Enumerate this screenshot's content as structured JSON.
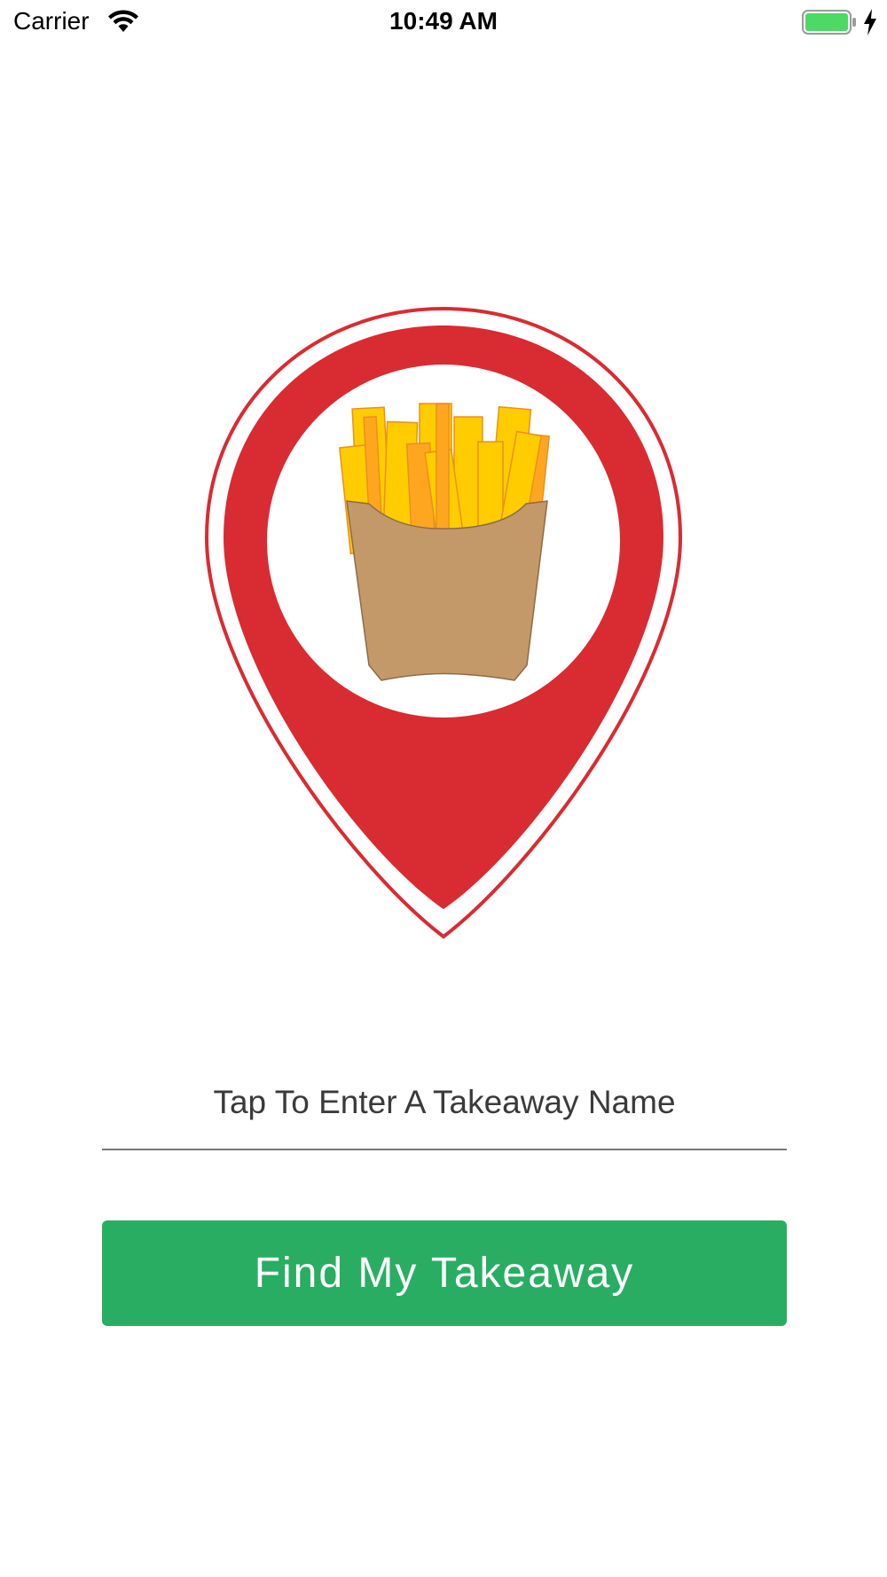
{
  "status_bar": {
    "carrier": "Carrier",
    "time": "10:49 AM",
    "wifi_icon": "wifi-icon",
    "battery_icon": "battery-charging-icon",
    "battery_color": "#4cd964"
  },
  "logo": {
    "icon": "map-pin-fries-icon",
    "pin_color": "#d92b32",
    "fries_color": "#ffcc00",
    "carton_color": "#c4996a"
  },
  "search": {
    "placeholder": "Tap To Enter A Takeaway Name",
    "value": ""
  },
  "action": {
    "label": "Find My Takeaway",
    "color": "#29ad62"
  }
}
